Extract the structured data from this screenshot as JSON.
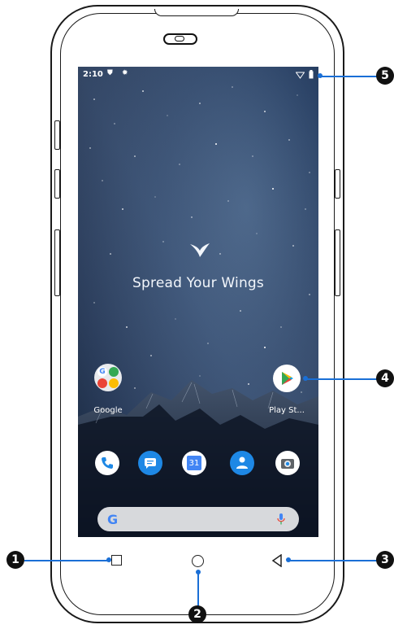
{
  "status_bar": {
    "time": "2:10"
  },
  "home": {
    "brand_text": "Spread Your Wings",
    "apps": [
      {
        "label": "Google"
      },
      {
        "label": "Play St..."
      }
    ],
    "calendar_day": "31"
  },
  "search": {
    "logo_letter": "G"
  },
  "callouts": [
    "1",
    "2",
    "3",
    "4",
    "5"
  ]
}
